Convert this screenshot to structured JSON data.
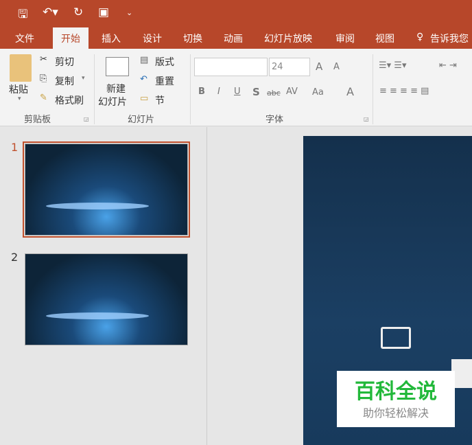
{
  "quick_access": {
    "save": "save-icon",
    "undo": "undo-icon",
    "redo": "redo-icon",
    "present": "present-icon",
    "customize": "⌄"
  },
  "tabs": [
    "文件",
    "开始",
    "插入",
    "设计",
    "切换",
    "动画",
    "幻灯片放映",
    "审阅",
    "视图"
  ],
  "tell_me": "告诉我您",
  "clipboard": {
    "paste": "粘贴",
    "cut": "剪切",
    "copy": "复制",
    "format_painter": "格式刷",
    "group": "剪贴板"
  },
  "slides_group": {
    "new_slide_1": "新建",
    "new_slide_2": "幻灯片",
    "layout": "版式",
    "reset": "重置",
    "section": "节",
    "group": "幻灯片"
  },
  "font": {
    "font_name": "",
    "font_size": "24",
    "bold": "B",
    "italic": "I",
    "underline": "U",
    "shadow": "S",
    "strike": "abc",
    "spacing": "AV",
    "case": "Aa",
    "color": "A",
    "grow": "A",
    "shrink": "A",
    "group": "字体"
  },
  "slides": [
    {
      "number": "1",
      "selected": true
    },
    {
      "number": "2",
      "selected": false
    }
  ],
  "watermark": {
    "title": "百科全说",
    "subtitle": "助你轻松解决",
    "title_color": "#22b83a"
  }
}
